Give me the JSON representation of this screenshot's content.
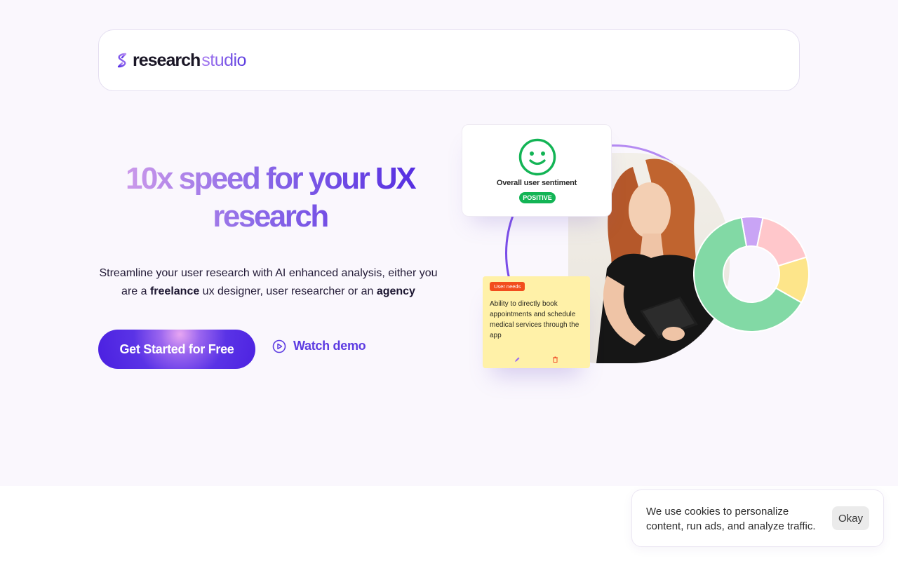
{
  "brand": {
    "name_dark": "research",
    "name_accent": "studio"
  },
  "hero": {
    "headline_line1": "10x speed for your UX",
    "headline_line2": "research",
    "subtitle_part1": "Streamline your user research with AI enhanced analysis, either you are a ",
    "subtitle_bold1": "freelance",
    "subtitle_part2": " ux designer, user researcher or an ",
    "subtitle_bold2": "agency",
    "cta_label": "Get Started for Free",
    "watch_label": "Watch demo"
  },
  "illustration": {
    "sentiment_title": "Overall user sentiment",
    "sentiment_badge": "POSITIVE",
    "note_tag": "User needs",
    "note_text": "Ability to directly book appointments and schedule medical services through the app",
    "donut_segments": [
      {
        "label": "green",
        "fraction": 0.64,
        "color": "#82d9a5"
      },
      {
        "label": "purple",
        "fraction": 0.06,
        "color": "#c9a4f5"
      },
      {
        "label": "pink",
        "fraction": 0.17,
        "color": "#ffc7cb"
      },
      {
        "label": "yellow",
        "fraction": 0.13,
        "color": "#fde58a"
      }
    ]
  },
  "cookie": {
    "message": "We use cookies to personalize content, run ads, and analyze traffic.",
    "button_label": "Okay"
  },
  "colors": {
    "accent": "#5a33e6",
    "page_bg": "#faf7fd",
    "positive": "#13b455",
    "note_bg": "#fff1a8",
    "tag_red": "#f24d1d"
  }
}
